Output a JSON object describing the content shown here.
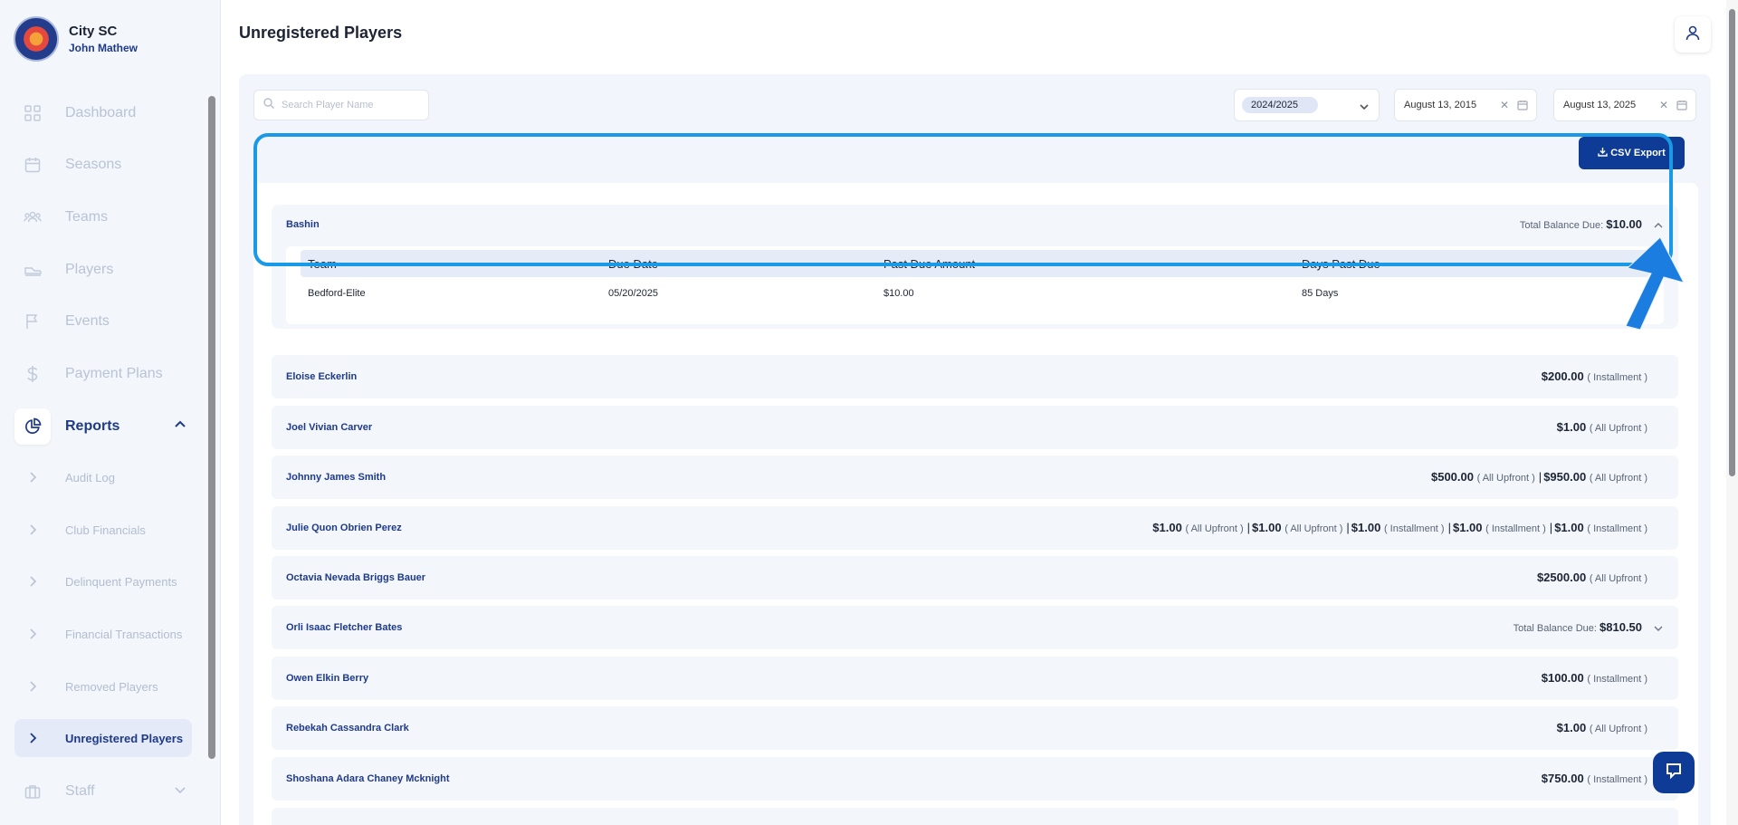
{
  "brand": {
    "club": "City SC",
    "user": "John Mathew"
  },
  "nav": {
    "items": [
      {
        "label": "Dashboard",
        "icon": "grid-icon"
      },
      {
        "label": "Seasons",
        "icon": "calendar-icon"
      },
      {
        "label": "Teams",
        "icon": "users-icon"
      },
      {
        "label": "Players",
        "icon": "cleat-icon"
      },
      {
        "label": "Events",
        "icon": "flag-icon"
      },
      {
        "label": "Payment Plans",
        "icon": "dollar-icon"
      },
      {
        "label": "Reports",
        "icon": "pie-chart-icon"
      },
      {
        "label": "Staff",
        "icon": "briefcase-icon"
      }
    ],
    "report_subitems": [
      {
        "label": "Audit Log"
      },
      {
        "label": "Club Financials"
      },
      {
        "label": "Delinquent Payments"
      },
      {
        "label": "Financial Transactions"
      },
      {
        "label": "Removed Players"
      },
      {
        "label": "Unregistered Players"
      }
    ]
  },
  "page": {
    "title": "Unregistered Players"
  },
  "filters": {
    "search_placeholder": "Search Player Name",
    "season": "2024/2025",
    "date_from": "August 13, 2015",
    "date_to": "August 13, 2025",
    "csv_label": "CSV Export"
  },
  "expanded": {
    "name": "Bashin",
    "total_label": "Total Balance Due:",
    "total_value": "$10.00",
    "columns": [
      "Team",
      "Due Date",
      "Past Due Amount",
      "Days Past Due"
    ],
    "rows": [
      [
        "Bedford-Elite",
        "05/20/2025",
        "$10.00",
        "85 Days"
      ]
    ]
  },
  "players": [
    {
      "name": "Eloise Eckerlin",
      "amounts": [
        [
          "$200.00",
          "( Installment )"
        ]
      ]
    },
    {
      "name": "Joel Vivian Carver",
      "amounts": [
        [
          "$1.00",
          "( All Upfront )"
        ]
      ]
    },
    {
      "name": "Johnny James Smith",
      "amounts": [
        [
          "$500.00",
          "( All Upfront )"
        ],
        [
          "$950.00",
          "( All Upfront )"
        ]
      ]
    },
    {
      "name": "Julie Quon Obrien Perez",
      "amounts": [
        [
          "$1.00",
          "( All Upfront )"
        ],
        [
          "$1.00",
          "( All Upfront )"
        ],
        [
          "$1.00",
          "( Installment )"
        ],
        [
          "$1.00",
          "( Installment )"
        ],
        [
          "$1.00",
          "( Installment )"
        ]
      ]
    },
    {
      "name": "Octavia Nevada Briggs Bauer",
      "amounts": [
        [
          "$2500.00",
          "( All Upfront )"
        ]
      ]
    },
    {
      "name": "Orli Isaac Fletcher Bates",
      "total_label": "Total Balance Due:",
      "total_value": "$810.50"
    },
    {
      "name": "Owen Elkin Berry",
      "amounts": [
        [
          "$100.00",
          "( Installment )"
        ]
      ]
    },
    {
      "name": "Rebekah Cassandra Clark",
      "amounts": [
        [
          "$1.00",
          "( All Upfront )"
        ]
      ]
    },
    {
      "name": "Shoshana Adara Chaney Mcknight",
      "amounts": [
        [
          "$750.00",
          "( Installment )"
        ]
      ]
    }
  ],
  "colors": {
    "accent": "#0d3b96",
    "highlight": "#1a9ae6",
    "link": "#1e3a8a"
  }
}
